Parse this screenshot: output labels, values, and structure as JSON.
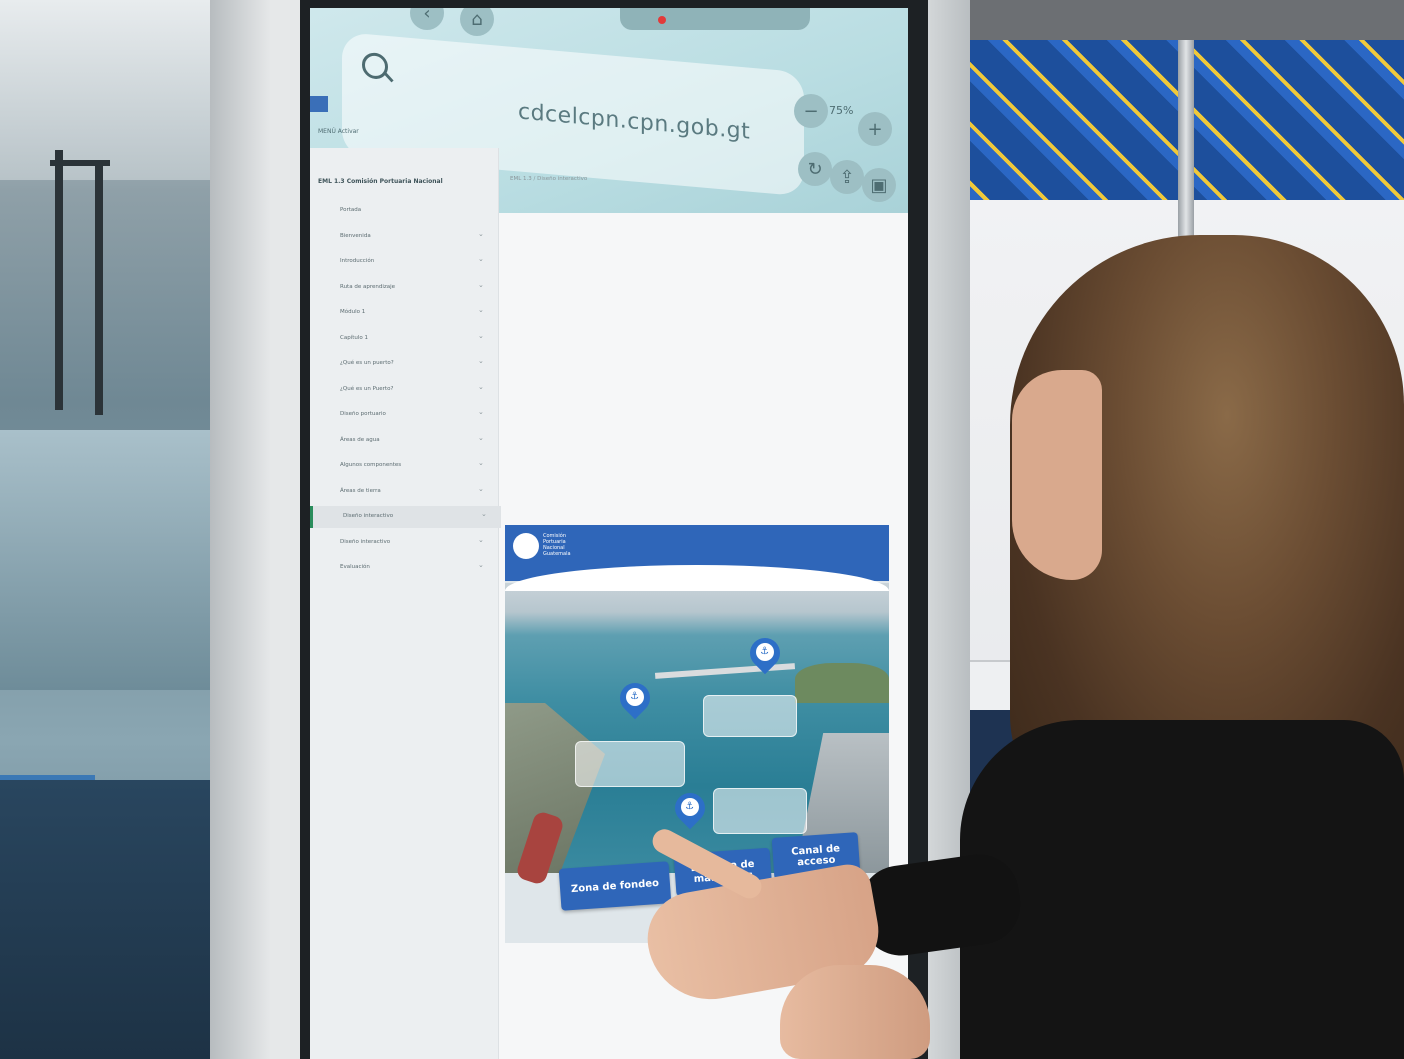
{
  "browser": {
    "url": "cdcelcpn.cpn.gob.gt",
    "zoom": "75%"
  },
  "app": {
    "tag": "",
    "menu_bar": "MENÚ   Activar"
  },
  "sidebar": {
    "header": "EML 1.3 Comisión Portuaria Nacional",
    "items": [
      {
        "label": "Portada"
      },
      {
        "label": "Bienvenida"
      },
      {
        "label": "Introducción"
      },
      {
        "label": "Ruta de aprendizaje"
      },
      {
        "label": "Módulo 1"
      },
      {
        "label": "Capítulo 1"
      },
      {
        "label": "¿Qué es un puerto?"
      },
      {
        "label": "¿Qué es un Puerto?"
      },
      {
        "label": "Diseño portuario"
      },
      {
        "label": "Áreas de agua"
      },
      {
        "label": "Algunos componentes"
      },
      {
        "label": "Áreas de tierra"
      },
      {
        "label": "Diseño interactivo"
      },
      {
        "label": "Diseño interactivo"
      },
      {
        "label": "Evaluación"
      }
    ],
    "active_index": 12
  },
  "content": {
    "breadcrumb": "EML 1.3 / Diseño interactivo"
  },
  "embed": {
    "logo_text": "Comisión\nPortuaria\nNacional\nGuatemala",
    "buttons": {
      "fondeo": "Zona de fondeo",
      "darsena": "Dársena de maniobras",
      "canal": "Canal de acceso"
    }
  },
  "colors": {
    "accent": "#2f66b9",
    "active_marker": "#2a8d5c"
  },
  "icons": [
    "search-icon",
    "home-icon",
    "back-icon",
    "zoom-minus-icon",
    "zoom-plus-icon",
    "reload-icon",
    "share-icon",
    "lock-icon",
    "chevron-down-icon",
    "map-marker-icon"
  ]
}
